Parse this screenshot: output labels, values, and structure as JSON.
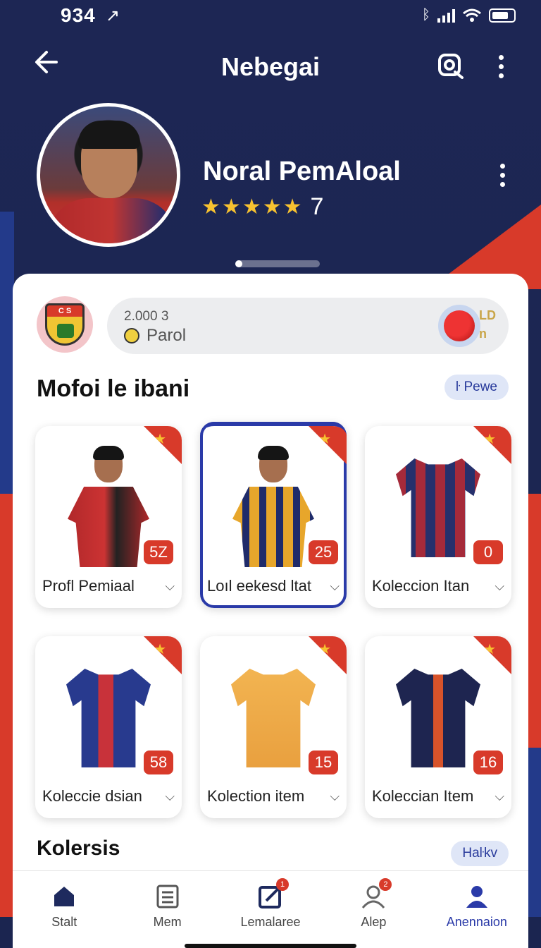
{
  "status": {
    "time": "934",
    "time_arrow": "↗"
  },
  "header": {
    "title": "Nebegai"
  },
  "profile": {
    "name": "Noral PemAloal",
    "rating": "7",
    "stars": 5
  },
  "club_search": {
    "value": "2.000 3",
    "label": "Parol",
    "side_text": "LD\nn"
  },
  "section1": {
    "title": "Mofoi le ibani",
    "pill": "ŀ Pewe"
  },
  "items": [
    {
      "label": "Profl Pemiaal",
      "badge": "5Z",
      "kind": "player-red"
    },
    {
      "label": "Loıl eekesd ltat",
      "badge": "25",
      "kind": "player-yellow"
    },
    {
      "label": "Koleccion Itan",
      "badge": "0",
      "kind": "jersey-stripes"
    },
    {
      "label": "Koleccie dsian",
      "badge": "58",
      "kind": "jersey-navy"
    },
    {
      "label": "Kolection item",
      "badge": "15",
      "kind": "jersey-yellow"
    },
    {
      "label": "Koleccian Item",
      "badge": "16",
      "kind": "jersey-dark"
    }
  ],
  "section2": {
    "title": "Kolersis",
    "pill": "Haŀkv"
  },
  "nav": [
    {
      "label": "Stalt",
      "icon": "home-icon",
      "badge": ""
    },
    {
      "label": "Mem",
      "icon": "list-icon",
      "badge": ""
    },
    {
      "label": "Lemalaree",
      "icon": "edit-icon",
      "badge": "1"
    },
    {
      "label": "Alep",
      "icon": "person-icon",
      "badge": "2"
    },
    {
      "label": "Anennaion",
      "icon": "account-icon",
      "badge": ""
    }
  ],
  "colors": {
    "navy": "#1c2550",
    "accent": "#2a3aa8",
    "red": "#d83a2a",
    "gold": "#f7c230"
  }
}
